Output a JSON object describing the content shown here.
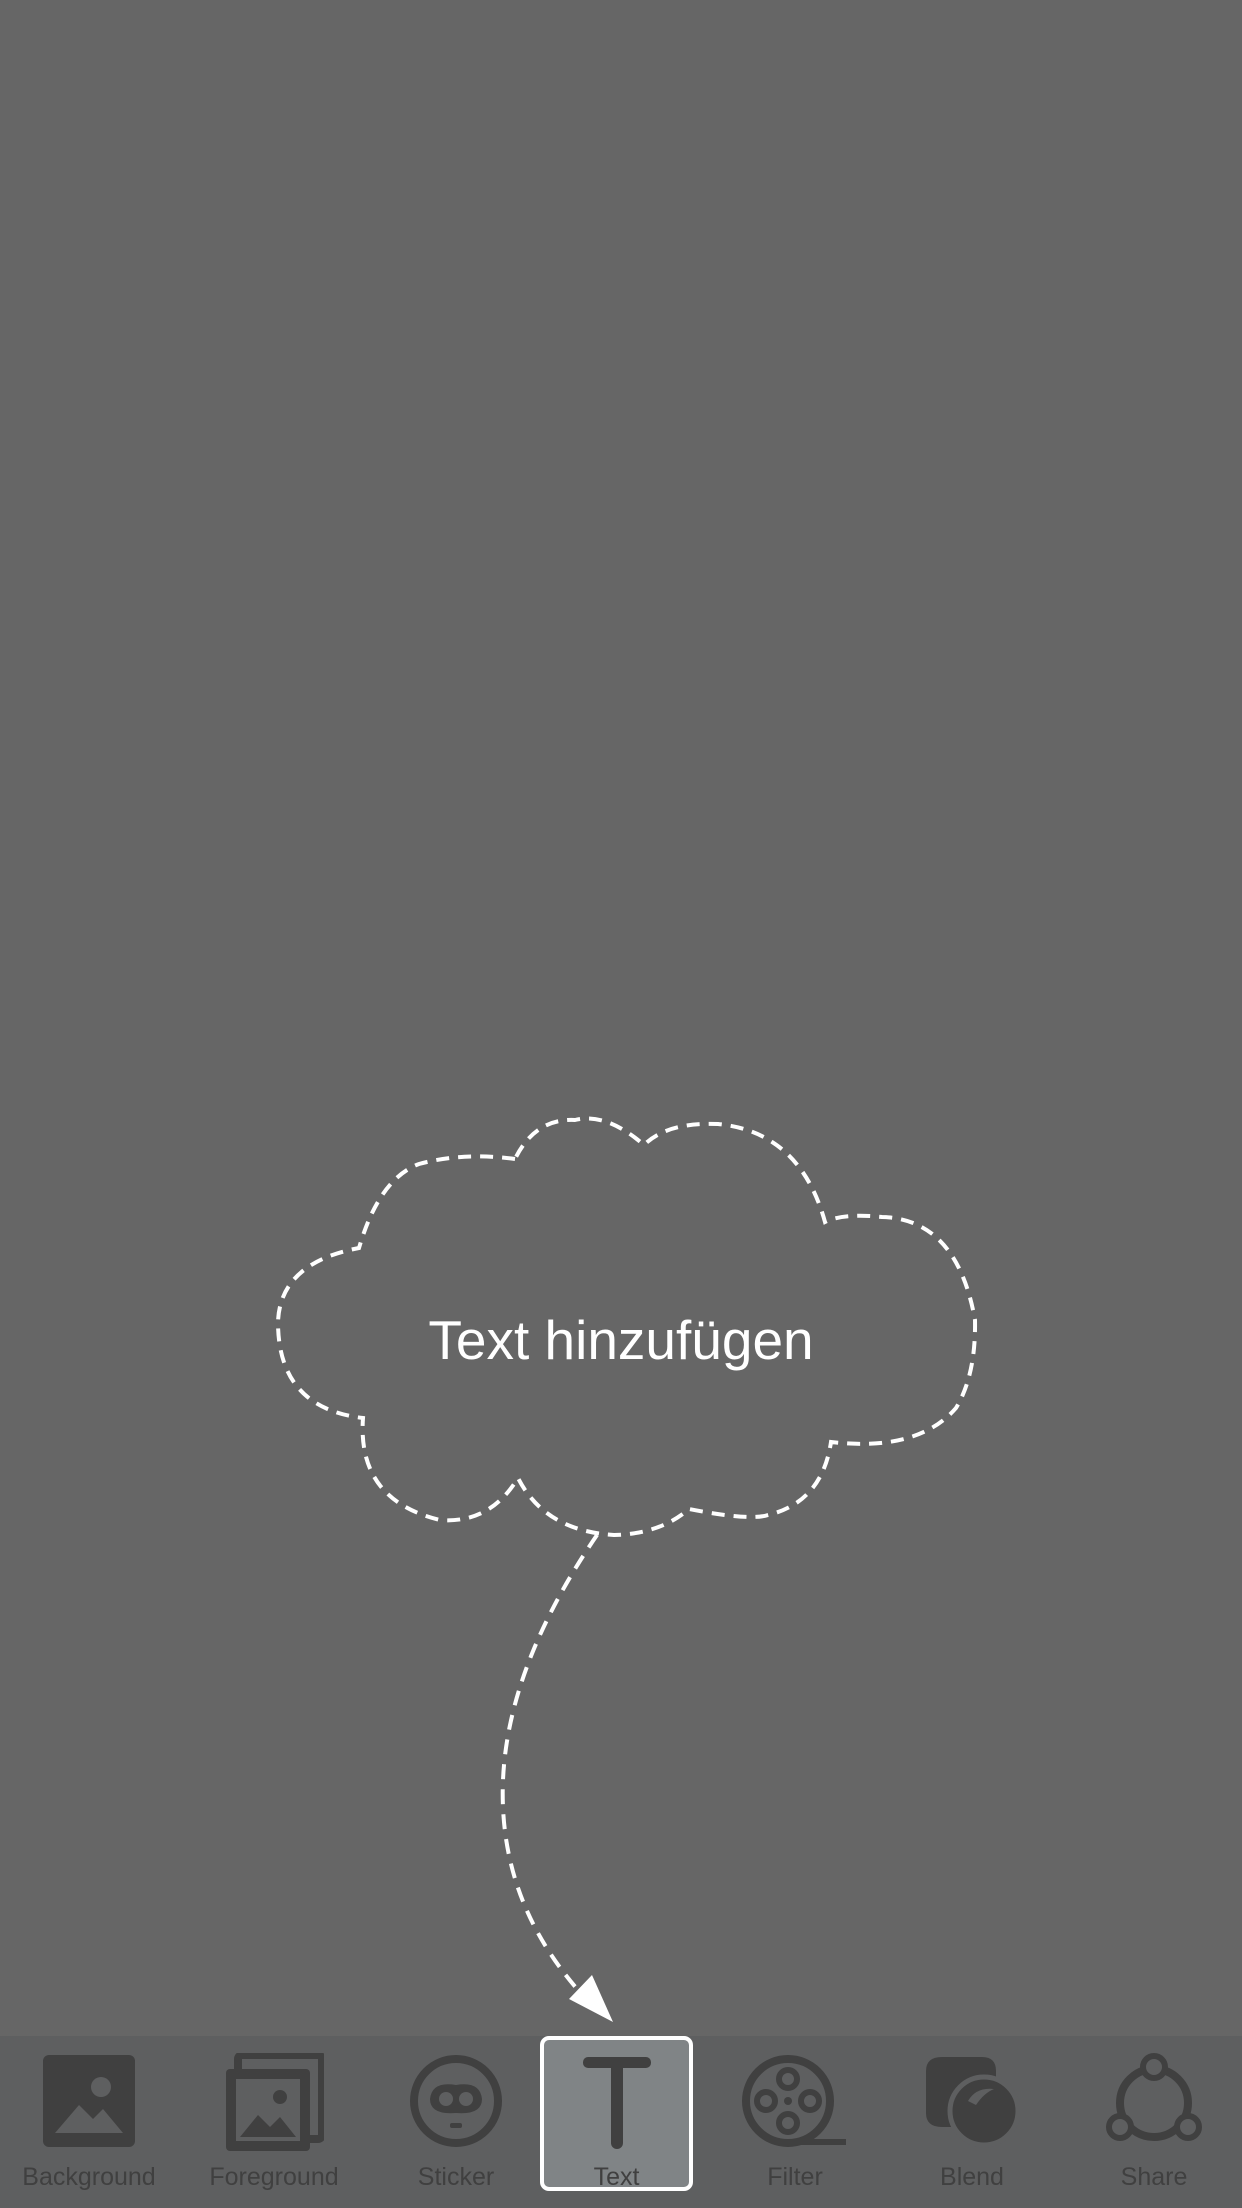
{
  "hint": {
    "text": "Text hinzufügen"
  },
  "toolbar": {
    "items": [
      {
        "label": "Background",
        "icon": "image-icon"
      },
      {
        "label": "Foreground",
        "icon": "stacked-images-icon"
      },
      {
        "label": "Sticker",
        "icon": "sticker-face-icon"
      },
      {
        "label": "Text",
        "icon": "text-t-icon",
        "selected": true
      },
      {
        "label": "Filter",
        "icon": "film-reel-icon"
      },
      {
        "label": "Blend",
        "icon": "blend-icon"
      },
      {
        "label": "Share",
        "icon": "share-icon"
      }
    ]
  },
  "colors": {
    "background": "#666666",
    "toolbar_background": "#5e5f60",
    "icon": "#404040",
    "selected_fill": "#808486",
    "accent": "#ffffff"
  }
}
